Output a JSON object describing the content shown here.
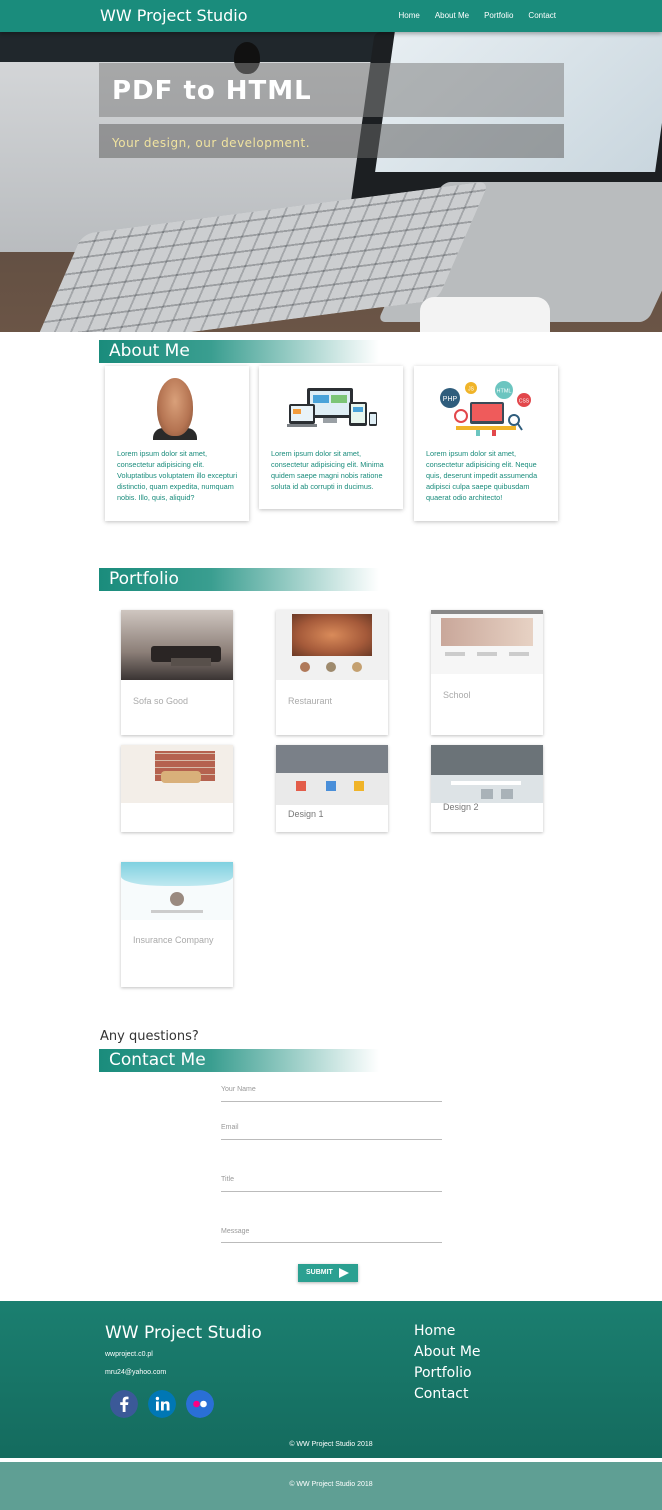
{
  "navbar": {
    "brand": "WW Project Studio",
    "links": [
      "Home",
      "About Me",
      "Portfolio",
      "Contact"
    ]
  },
  "hero": {
    "title": "PDF to HTML",
    "subtitle": "Your design, our development."
  },
  "about": {
    "heading": "About Me",
    "cards": [
      {
        "text": "Lorem ipsum dolor sit amet, consectetur adipisicing elit. Voluptatibus voluptatem illo excepturi distinctio, quam expedita, numquam nobis. Illo, quis, aliquid?"
      },
      {
        "text": "Lorem ipsum dolor sit amet, consectetur adipisicing elit. Minima quidem saepe magni nobis ratione soluta id ab corrupti in ducimus."
      },
      {
        "text": "Lorem ipsum dolor sit amet, consectetur adipisicing elit. Neque quis, deserunt impedit assumenda adipisci culpa saepe quibusdam quaerat odio architecto!"
      }
    ],
    "icon_labels": [
      "PHP",
      "JS",
      "HTML",
      "CSS"
    ]
  },
  "portfolio": {
    "heading": "Portfolio",
    "items": [
      {
        "title": "Sofa so Good"
      },
      {
        "title": "Restaurant"
      },
      {
        "title": "School"
      },
      {
        "title": ""
      },
      {
        "title": "Design 1"
      },
      {
        "title": "Design 2"
      },
      {
        "title": "Insurance Company"
      }
    ]
  },
  "contact": {
    "question": "Any questions?",
    "heading": "Contact Me",
    "fields": {
      "name": "Your Name",
      "email": "Email",
      "title": "Title",
      "message": "Message"
    },
    "submit": "SUBMIT"
  },
  "footer": {
    "brand": "WW Project Studio",
    "email1": "wwproject.c0.pl",
    "email2": "mru24@yahoo.com",
    "links": [
      "Home",
      "About Me",
      "Portfolio",
      "Contact"
    ],
    "copyright": "© WW Project Studio 2018",
    "bottom_copyright": "© WW Project Studio 2018"
  },
  "colors": {
    "primary": "#1a8c7c",
    "footer": "#146b5e",
    "bottom_bar": "#5f9f94",
    "facebook": "#3b5998",
    "linkedin": "#0077b5",
    "flickr": "#2a6fd6"
  },
  "icons": [
    "facebook-icon",
    "linkedin-icon",
    "flickr-icon",
    "send-arrow-icon"
  ]
}
